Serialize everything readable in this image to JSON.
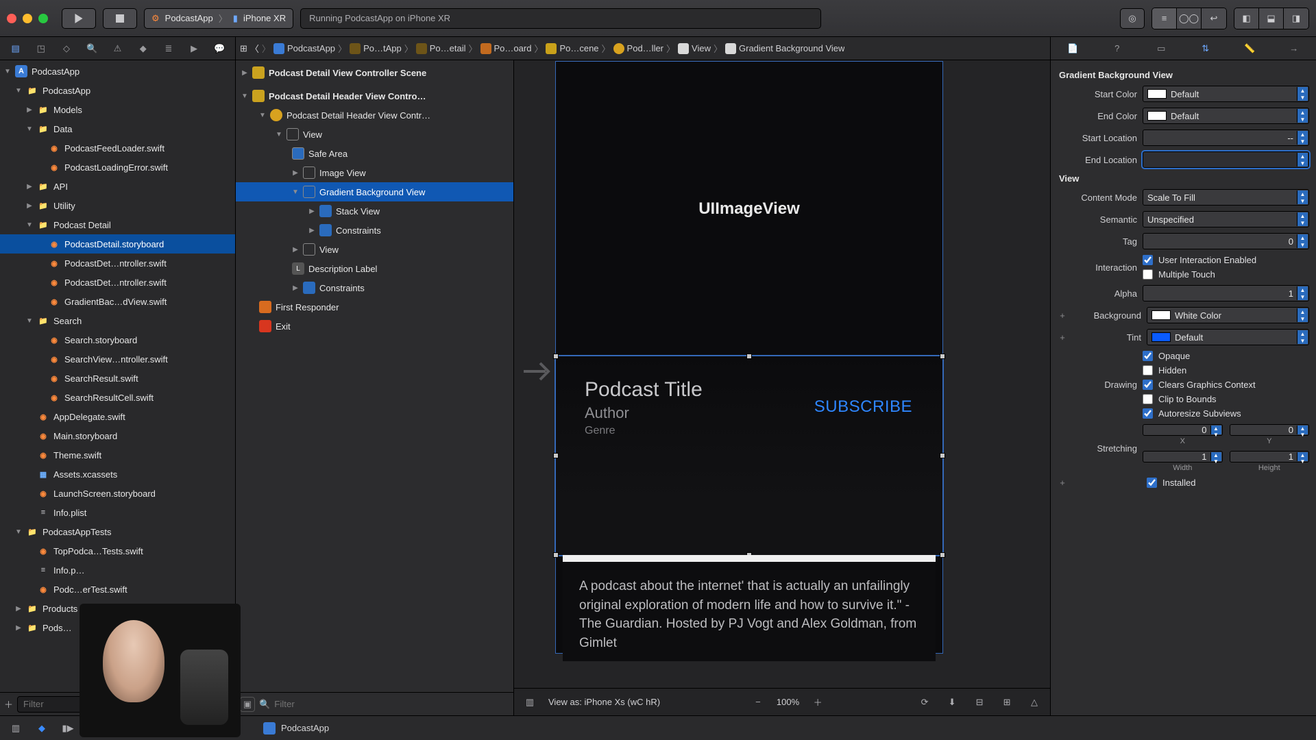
{
  "toolbar": {
    "scheme_target": "PodcastApp",
    "scheme_device": "iPhone XR",
    "activity": "Running PodcastApp on iPhone XR"
  },
  "navigator": {
    "root": "PodcastApp",
    "app_group": "PodcastApp",
    "groups": {
      "models": "Models",
      "data": "Data",
      "api": "API",
      "utility": "Utility",
      "podcast_detail": "Podcast Detail",
      "search": "Search",
      "tests": "PodcastAppTests",
      "products": "Products",
      "pods": "Pods…"
    },
    "files": {
      "feedloader": "PodcastFeedLoader.swift",
      "loadingerror": "PodcastLoadingError.swift",
      "detail_sb": "PodcastDetail.storyboard",
      "detail_c1": "PodcastDet…ntroller.swift",
      "detail_c2": "PodcastDet…ntroller.swift",
      "gradient": "GradientBac…dView.swift",
      "search_sb": "Search.storyboard",
      "search_vc": "SearchView…ntroller.swift",
      "search_res": "SearchResult.swift",
      "search_cell": "SearchResultCell.swift",
      "appdelegate": "AppDelegate.swift",
      "main_sb": "Main.storyboard",
      "theme": "Theme.swift",
      "assets": "Assets.xcassets",
      "launch": "LaunchScreen.storyboard",
      "info": "Info.plist",
      "toptests": "TopPodca…Tests.swift",
      "tests_info": "Info.p…",
      "loader_test": "Podc…erTest.swift"
    },
    "filter_placeholder": "Filter"
  },
  "jumpbar": {
    "project": "PodcastApp",
    "folder1": "Po…tApp",
    "folder2": "Po…etail",
    "storyboard": "Po…oard",
    "scene": "Po…cene",
    "controller": "Pod…ller",
    "view": "View",
    "selected": "Gradient Background View"
  },
  "outline": {
    "scene": "Podcast Detail View Controller Scene",
    "vc": "Podcast Detail Header View Contro…",
    "vc_full": "Podcast Detail Header View Contr…",
    "view": "View",
    "safe": "Safe Area",
    "image": "Image View",
    "gradient": "Gradient Background View",
    "stack": "Stack View",
    "constraints": "Constraints",
    "view2": "View",
    "desc": "Description Label",
    "constraints2": "Constraints",
    "first": "First Responder",
    "exit": "Exit",
    "filter_placeholder": "Filter"
  },
  "canvas": {
    "image_label": "UIImageView",
    "podcast_title": "Podcast Title",
    "author": "Author",
    "genre": "Genre",
    "subscribe": "SUBSCRIBE",
    "description": "A podcast about the internet' that is actually an unfailingly original exploration of modern life and how to survive it.\" - The Guardian. Hosted by PJ Vogt and Alex Goldman, from Gimlet",
    "view_as": "View as: iPhone Xs (wC hR)",
    "zoom": "100%"
  },
  "debugbar": {
    "process": "PodcastApp"
  },
  "inspector": {
    "section1": "Gradient Background View",
    "start_color_l": "Start Color",
    "end_color_l": "End Color",
    "start_loc_l": "Start Location",
    "end_loc_l": "End Location",
    "default": "Default",
    "start_loc_v": "--",
    "end_loc_v": "",
    "section2": "View",
    "content_mode_l": "Content Mode",
    "content_mode_v": "Scale To Fill",
    "semantic_l": "Semantic",
    "semantic_v": "Unspecified",
    "tag_l": "Tag",
    "tag_v": "0",
    "interaction_l": "Interaction",
    "uie": "User Interaction Enabled",
    "mt": "Multiple Touch",
    "alpha_l": "Alpha",
    "alpha_v": "1",
    "background_l": "Background",
    "background_v": "White Color",
    "tint_l": "Tint",
    "tint_v": "Default",
    "drawing_l": "Drawing",
    "opaque": "Opaque",
    "hidden": "Hidden",
    "clears": "Clears Graphics Context",
    "clip": "Clip to Bounds",
    "autoresize": "Autoresize Subviews",
    "stretching_l": "Stretching",
    "sx": "0",
    "sy": "0",
    "sw": "1",
    "sh": "1",
    "x_l": "X",
    "y_l": "Y",
    "w_l": "Width",
    "h_l": "Height",
    "installed": "Installed"
  }
}
